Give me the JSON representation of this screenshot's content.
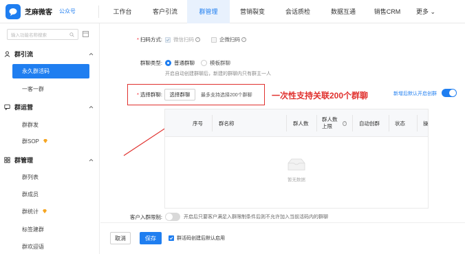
{
  "app": {
    "name": "芝麻微客",
    "account": "公众号"
  },
  "nav": [
    "工作台",
    "客户引流",
    "群管理",
    "营销裂变",
    "会话质检",
    "数据互通",
    "销售CRM",
    "更多"
  ],
  "nav_active": "群管理",
  "sidebar": {
    "search_placeholder": "输入功能名称搜索",
    "groups": [
      {
        "label": "群引流",
        "items": [
          "永久群活码",
          "一客一群"
        ]
      },
      {
        "label": "群运营",
        "items": [
          "群群发",
          "群SOP"
        ]
      },
      {
        "label": "群管理",
        "items": [
          "群列表",
          "群成员",
          "群统计",
          "标签建群",
          "群欢迎语"
        ]
      }
    ],
    "active_item": "永久群活码"
  },
  "form": {
    "scan_mode": {
      "label": "扫码方式:",
      "options": [
        "微信扫码",
        "企微扫码"
      ]
    },
    "group_type": {
      "label": "群聊类型:",
      "options": [
        "普通群聊",
        "模板群聊"
      ],
      "hint": "开启自动创建群聊后，新建的群聊内只有群主一人"
    },
    "select_group": {
      "label": "选择群聊:",
      "button": "选择群聊",
      "hint": "最多支持选择200个群聊"
    },
    "annotation": "一次性支持关联200个群聊",
    "auto_create_toggle": "新增后默认开启创群",
    "table": {
      "columns": [
        "序号",
        "群名称",
        "群人数",
        "群人数上限",
        "自动创群",
        "状态",
        "操"
      ],
      "empty_text": "暂无数据"
    },
    "limit": {
      "label": "客户入群限制:",
      "hint": "开启后只要客户满足入群限制条件后则不允许加入当前活码内的群聊"
    }
  },
  "footer": {
    "cancel": "取消",
    "save": "保存",
    "check_label": "群活码创建后默认启用"
  },
  "colors": {
    "primary": "#1f7ef0",
    "annotation": "#e0302d"
  }
}
